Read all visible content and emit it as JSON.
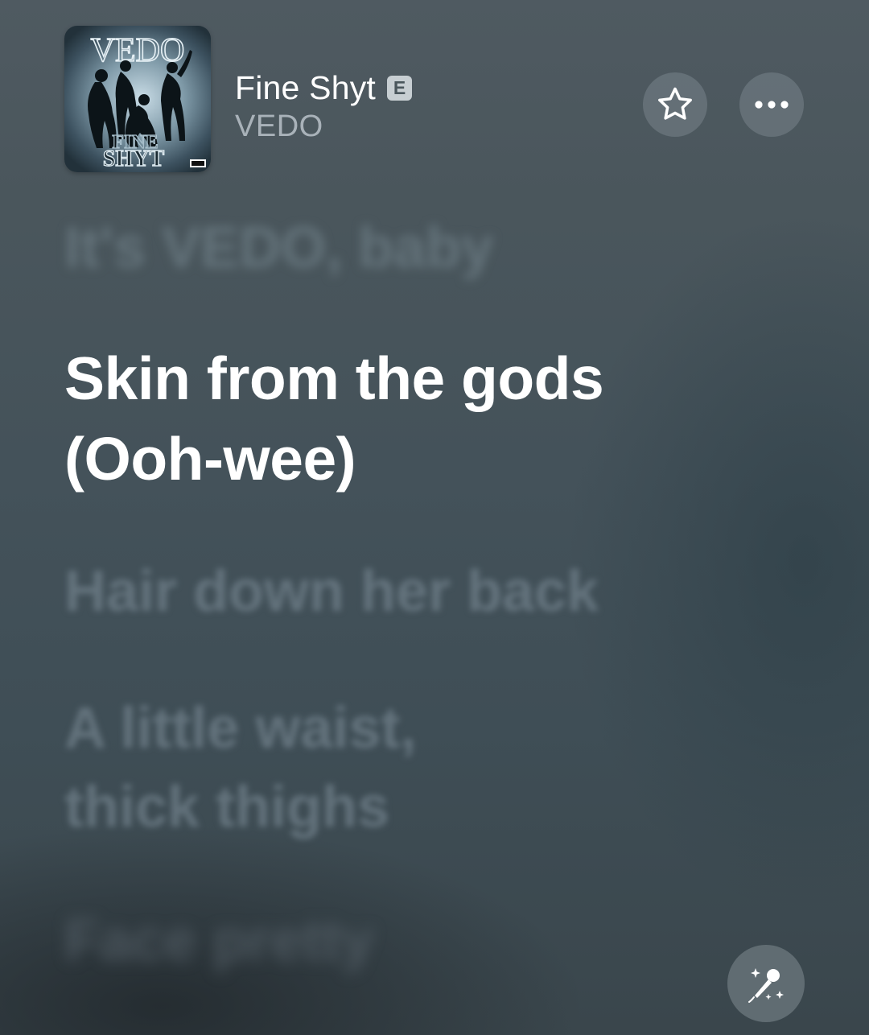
{
  "now_playing": {
    "artwork_text": {
      "artist": "VEDO",
      "title_line_1": "FINE",
      "title_line_2": "SHYT"
    },
    "title": "Fine Shyt",
    "explicit_badge": "E",
    "artist": "VEDO"
  },
  "actions": {
    "favorite_icon": "star-icon",
    "more_icon": "ellipsis-icon",
    "sing_icon": "microphone-sparkle-icon"
  },
  "lyrics": {
    "previous": "It's VEDO, baby",
    "current": [
      "Skin from the gods",
      "(Ooh-wee)"
    ],
    "upcoming": [
      [
        "Hair down her back"
      ],
      [
        "A little waist,",
        "thick thighs"
      ],
      [
        "Face pretty"
      ]
    ]
  },
  "colors": {
    "background_top": "#4f5a61",
    "background_bottom": "#3a464c",
    "active_lyric": "#ffffff",
    "inactive_lyric": "#6e7d86",
    "button_fill": "#78848a"
  }
}
